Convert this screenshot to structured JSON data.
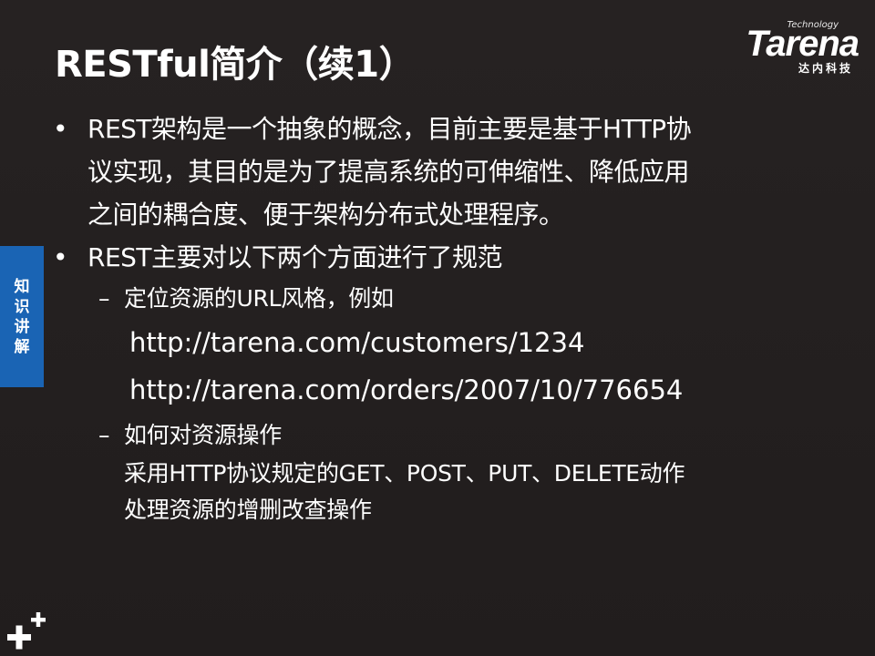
{
  "title": "RESTful简介（续1）",
  "logo": {
    "technology": "Technology",
    "brand": "Tarena",
    "cn": "达内科技"
  },
  "side_tab": [
    "知",
    "识",
    "讲",
    "解"
  ],
  "bullets": [
    {
      "marker": "•",
      "lines": [
        "REST架构是一个抽象的概念，目前主要是基于HTTP协",
        "议实现，其目的是为了提高系统的可伸缩性、降低应用",
        "之间的耦合度、便于架构分布式处理程序。"
      ]
    },
    {
      "marker": "•",
      "lines": [
        "REST主要对以下两个方面进行了规范"
      ]
    }
  ],
  "subs": [
    {
      "marker": "–",
      "text": "定位资源的URL风格，例如",
      "urls": [
        "http://tarena.com/customers/1234",
        "http://tarena.com/orders/2007/10/776654"
      ]
    },
    {
      "marker": "–",
      "text": "如何对资源操作",
      "notes": [
        "采用HTTP协议规定的GET、POST、PUT、DELETE动作",
        "处理资源的增删改查操作"
      ]
    }
  ],
  "colors": {
    "background": "#231f1f",
    "side_tab": "#1a64b4",
    "text": "#ffffff"
  },
  "icons": [
    "plus-plus-icon"
  ]
}
